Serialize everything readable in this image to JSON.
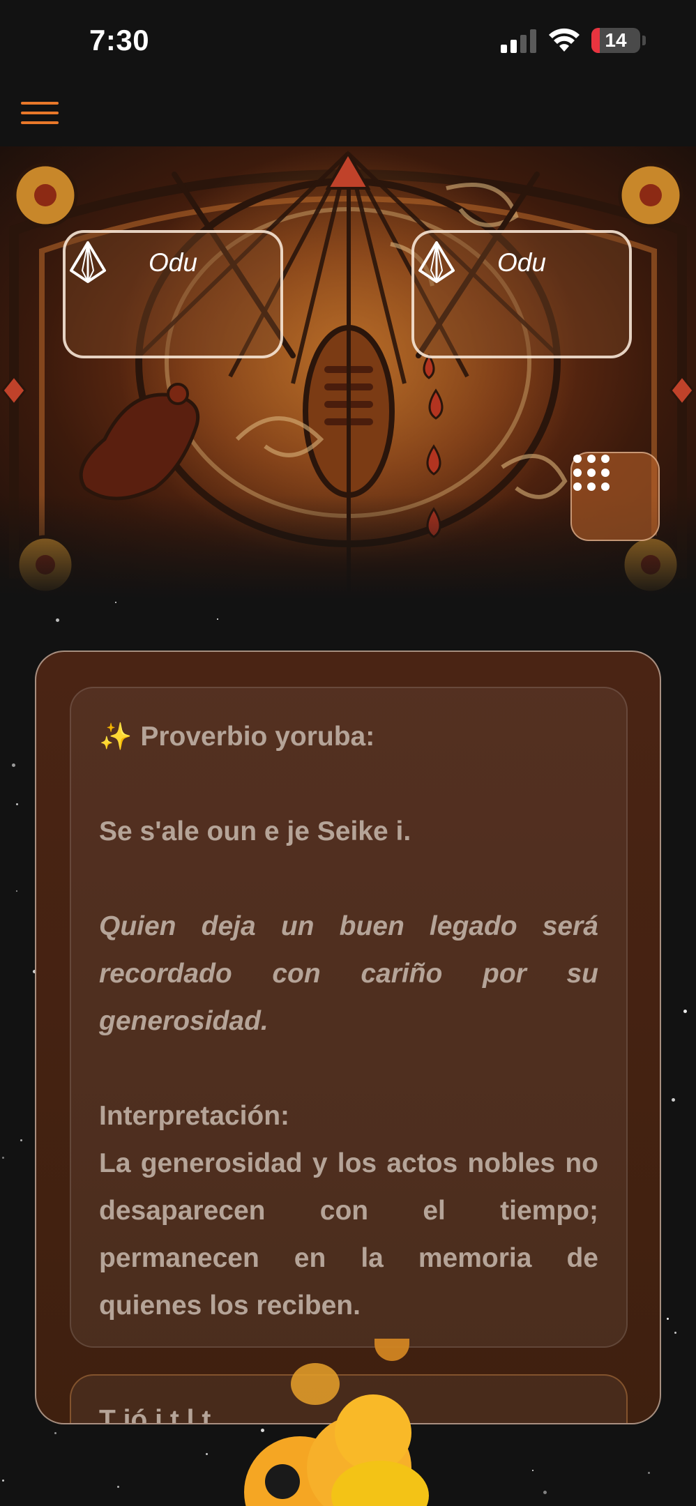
{
  "status_bar": {
    "time": "7:30",
    "battery_level": "14",
    "battery_color": "#e8343f"
  },
  "header": {
    "menu_icon": "hamburger-menu-icon",
    "accent_color": "#e8782a"
  },
  "hero": {
    "odu_left": {
      "icon": "crystal-gem-icon",
      "label": "Odu"
    },
    "odu_right": {
      "icon": "crystal-gem-icon",
      "label": "Odu"
    },
    "grid_button_icon": "dots-grid-icon"
  },
  "proverb": {
    "sparkle_icon": "✨",
    "heading": "Proverbio yoruba:",
    "yoruba_text": "Se s'ale oun e je Seike i.",
    "translation": "Quien deja un buen legado será recordado con cariño por su generosidad.",
    "interpretation_label": "Interpretación:",
    "interpretation_text": "La generosidad y los actos nobles no desaparecen con el tiempo; permanecen en la memoria de quienes los reciben."
  },
  "next_card": {
    "partial_text": "T          ió      i      t    l                      t"
  }
}
